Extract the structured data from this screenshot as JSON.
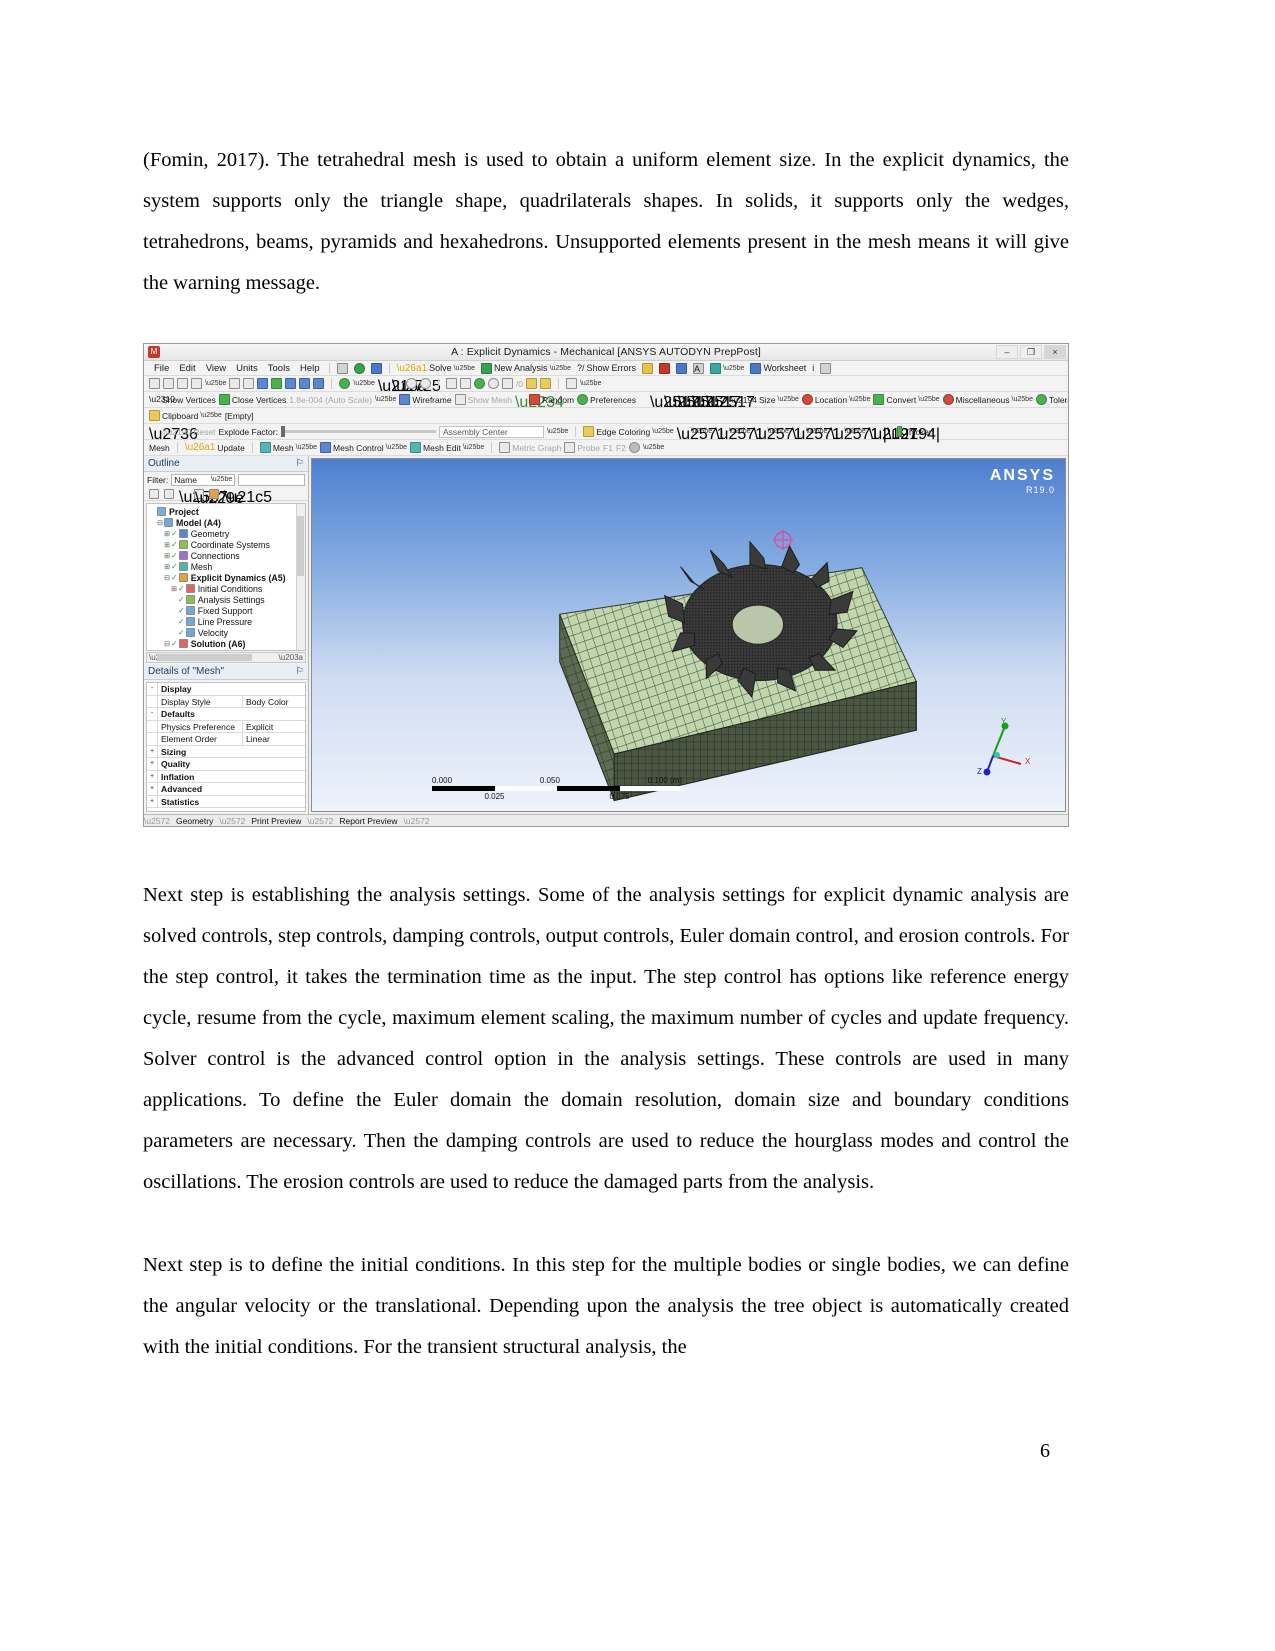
{
  "document": {
    "paragraphs": {
      "top": "(Fomin, 2017).   The tetrahedral mesh is used to obtain a uniform element size. In the explicit dynamics, the system supports only the triangle shape, quadrilaterals shapes. In solids, it supports only the wedges, tetrahedrons, beams, pyramids and hexahedrons. Unsupported elements present in the mesh means it will give the warning message.",
      "middle": "Next step is establishing the analysis settings.  Some of the analysis settings for explicit dynamic analysis are solved controls, step controls, damping controls, output controls, Euler domain control, and erosion controls. For the step control, it takes the termination time as the input. The step control has options like reference energy cycle, resume from the cycle, maximum element scaling, the maximum number of cycles and update frequency. Solver control is the advanced control option in the analysis settings.  These controls are used in many applications. To define the Euler domain the domain resolution, domain size and boundary conditions parameters are necessary. Then the damping controls are used to reduce the hourglass modes and control the oscillations.  The erosion controls are used to reduce the damaged parts from the analysis.",
      "bottom": "Next step is to define the initial conditions. In this step for the multiple bodies or single bodies, we can define the angular velocity or the translational. Depending upon the analysis the tree object is automatically created with the initial conditions. For the transient structural analysis, the"
    },
    "page_number": "6"
  },
  "app": {
    "titlebar": {
      "title": "A : Explicit Dynamics - Mechanical [ANSYS AUTODYN PrepPost]",
      "app_icon": "M",
      "minimize": "–",
      "restore": "❐",
      "close": "×"
    },
    "menu": [
      "File",
      "Edit",
      "View",
      "Units",
      "Tools",
      "Help"
    ],
    "menu_buttons": [
      {
        "label": "",
        "icon": "generate-mesh-icon"
      },
      {
        "label": "",
        "icon": "green-check-icon"
      },
      {
        "label": "",
        "icon": "connect-icon"
      },
      {
        "label": "Solve",
        "icon": "lightning-icon"
      },
      {
        "label": "New Analysis",
        "icon": "new-analysis-icon"
      },
      {
        "label": "Show Errors",
        "icon": "show-errors-icon"
      },
      {
        "label": "",
        "icon": "named-selection-icon"
      },
      {
        "label": "",
        "icon": "chart-icon"
      },
      {
        "label": "",
        "icon": "image-icon"
      },
      {
        "label": "",
        "icon": "annotation-icon"
      },
      {
        "label": "",
        "icon": "figure-icon"
      },
      {
        "label": "Worksheet",
        "icon": "worksheet-icon"
      },
      {
        "label": "",
        "icon": "info-icon"
      },
      {
        "label": "",
        "icon": "tag-icon"
      }
    ],
    "toolbar2": [
      "select-vertex-icon",
      "select-edge-icon",
      "select-face-icon",
      "select-body-icon",
      "cursor-mode-icon",
      "box-select-icon",
      "box-volume-icon",
      "lasso-icon",
      "lasso-volume-icon",
      "extend-to-adjacent-icon",
      "extend-to-limits-icon",
      "extend-to-connection-icon",
      "rotate-icon",
      "pan-icon",
      "zoom-icon",
      "box-zoom-icon",
      "zoom-to-fit-icon",
      "magnify-icon",
      "previous-view-icon",
      "next-view-icon",
      "set-iso-icon",
      "iso-angle-icon",
      "look-at-icon",
      "print-preview-icon",
      "viewports-icon"
    ],
    "toolbar3": {
      "show_vertices": "Show Vertices",
      "close_vertices": "Close Vertices",
      "auto_scale_value": "1.8e-004 (Auto Scale)",
      "wireframe": "Wireframe",
      "show_mesh": "Show Mesh",
      "random": "Random",
      "preferences": "Preferences",
      "edge_tools": [
        "edge-thin-icon",
        "edge-med-icon",
        "edge-thick-icon",
        "edge-heavy-icon",
        "edge-max-icon"
      ],
      "size": "Size",
      "location": "Location",
      "convert": "Convert",
      "miscellaneous": "Miscellaneous",
      "tolerances": "Tolerances"
    },
    "clipboard_row": {
      "clipboard": "Clipboard",
      "empty": "[Empty]"
    },
    "explode_row": {
      "reset": "Reset",
      "explode_label": "Explode Factor:",
      "assembly_center": "Assembly Center",
      "edge_coloring": "Edge Coloring",
      "thicken": "Thicken"
    },
    "mesh_row": {
      "mesh": "Mesh",
      "update": "Update",
      "mesh_menu": "Mesh",
      "mesh_control": "Mesh Control",
      "mesh_edit": "Mesh Edit",
      "metric_graph": "Metric Graph",
      "probe": "Probe",
      "f1": "F1",
      "f2": "F2"
    },
    "outline": {
      "title": "Outline",
      "pin": "⚐",
      "filter_label": "Filter:",
      "filter_value": "Name",
      "filter_text": "",
      "tree": [
        {
          "label": "Project",
          "indent": 0,
          "expander": "",
          "icon": "project-icon",
          "bold": true
        },
        {
          "label": "Model (A4)",
          "indent": 1,
          "expander": "-",
          "icon": "model-icon",
          "bold": true
        },
        {
          "label": "Geometry",
          "indent": 2,
          "expander": "+",
          "icon": "geometry-icon",
          "bold": false
        },
        {
          "label": "Coordinate Systems",
          "indent": 2,
          "expander": "+",
          "icon": "coordinate-icon",
          "bold": false
        },
        {
          "label": "Connections",
          "indent": 2,
          "expander": "+",
          "icon": "connections-icon",
          "bold": false
        },
        {
          "label": "Mesh",
          "indent": 2,
          "expander": "+",
          "icon": "mesh-icon",
          "bold": false
        },
        {
          "label": "Explicit Dynamics (A5)",
          "indent": 2,
          "expander": "-",
          "icon": "explicit-dynamics-icon",
          "bold": true
        },
        {
          "label": "Initial Conditions",
          "indent": 3,
          "expander": "+",
          "icon": "initial-conditions-icon",
          "bold": false
        },
        {
          "label": "Analysis Settings",
          "indent": 3,
          "expander": "",
          "icon": "analysis-settings-icon",
          "bold": false
        },
        {
          "label": "Fixed Support",
          "indent": 3,
          "expander": "",
          "icon": "fixed-support-icon",
          "bold": false
        },
        {
          "label": "Line Pressure",
          "indent": 3,
          "expander": "",
          "icon": "line-pressure-icon",
          "bold": false
        },
        {
          "label": "Velocity",
          "indent": 3,
          "expander": "",
          "icon": "velocity-icon",
          "bold": false
        },
        {
          "label": "Solution (A6)",
          "indent": 2,
          "expander": "-",
          "icon": "solution-icon",
          "bold": true
        }
      ]
    },
    "details": {
      "title": "Details of \"Mesh\"",
      "pin": "⚐",
      "rows": [
        {
          "toggle": "-",
          "name": "Display",
          "value": "",
          "section": true
        },
        {
          "toggle": "",
          "name": "Display Style",
          "value": "Body Color",
          "section": false
        },
        {
          "toggle": "-",
          "name": "Defaults",
          "value": "",
          "section": true
        },
        {
          "toggle": "",
          "name": "Physics Preference",
          "value": "Explicit",
          "section": false
        },
        {
          "toggle": "",
          "name": "Element Order",
          "value": "Linear",
          "section": false
        },
        {
          "toggle": "+",
          "name": "Sizing",
          "value": "",
          "section": true
        },
        {
          "toggle": "+",
          "name": "Quality",
          "value": "",
          "section": true
        },
        {
          "toggle": "+",
          "name": "Inflation",
          "value": "",
          "section": true
        },
        {
          "toggle": "+",
          "name": "Advanced",
          "value": "",
          "section": true
        },
        {
          "toggle": "+",
          "name": "Statistics",
          "value": "",
          "section": true
        }
      ]
    },
    "viewport": {
      "logo_line1": "ANSYS",
      "logo_line2": "R19.0",
      "scale_labels": [
        "0.000",
        "0.050",
        "0.100 (m)"
      ],
      "scale_sub_labels": [
        "0.025",
        "0.075"
      ],
      "axis_x": "X",
      "axis_y": "Y",
      "axis_z": "Z"
    },
    "bottom_tabs": [
      "Geometry",
      "Print Preview",
      "Report Preview"
    ]
  },
  "colors": {
    "accent_blue": "#21405f",
    "ansys_white": "#ffffff",
    "mesh_green": "#9db98b",
    "mesh_dark": "#3e4c3a",
    "axis_x": "#d02020",
    "axis_y": "#17a017",
    "axis_z": "#2020c8"
  }
}
